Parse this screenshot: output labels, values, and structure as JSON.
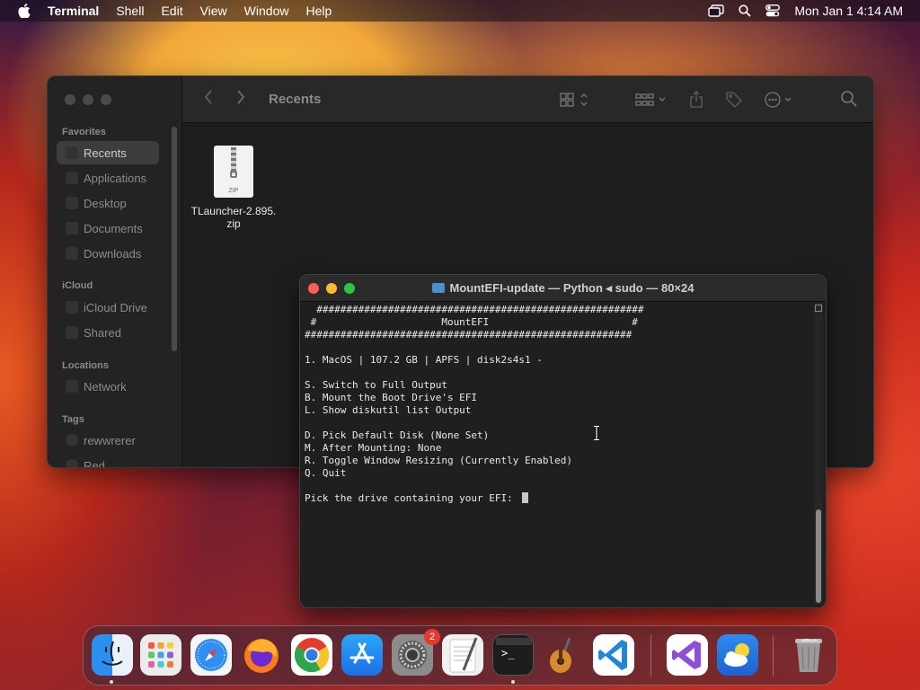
{
  "menubar": {
    "app": "Terminal",
    "menus": [
      "Shell",
      "Edit",
      "View",
      "Window",
      "Help"
    ],
    "clock": "Mon Jan 1  4:14 AM"
  },
  "finder": {
    "title": "Recents",
    "sections": {
      "favorites": "Favorites",
      "icloud": "iCloud",
      "locations": "Locations",
      "tags": "Tags"
    },
    "favorites": [
      "Recents",
      "Applications",
      "Desktop",
      "Documents",
      "Downloads"
    ],
    "icloud": [
      "iCloud Drive",
      "Shared"
    ],
    "locations": [
      "Network"
    ],
    "tags": [
      "rewwrerer",
      "Red"
    ],
    "file": {
      "name_line1": "TLauncher-2.895.",
      "name_line2": "zip",
      "icon_label": "ZIP"
    }
  },
  "terminal": {
    "title": "MountEFI-update — Python ◂ sudo — 80×24",
    "lines": [
      "  #######################################################",
      " #                     MountEFI                        #",
      "#######################################################",
      "",
      "1. MacOS | 107.2 GB | APFS | disk2s4s1 -",
      "",
      "S. Switch to Full Output",
      "B. Mount the Boot Drive's EFI",
      "L. Show diskutil list Output",
      "",
      "D. Pick Default Disk (None Set)",
      "M. After Mounting: None",
      "R. Toggle Window Resizing (Currently Enabled)",
      "Q. Quit",
      ""
    ],
    "prompt": "Pick the drive containing your EFI: "
  },
  "dock": {
    "settings_badge": "2"
  },
  "colors": {
    "close": "#ff5f57",
    "minimize": "#febc2e",
    "zoom": "#28c840"
  }
}
